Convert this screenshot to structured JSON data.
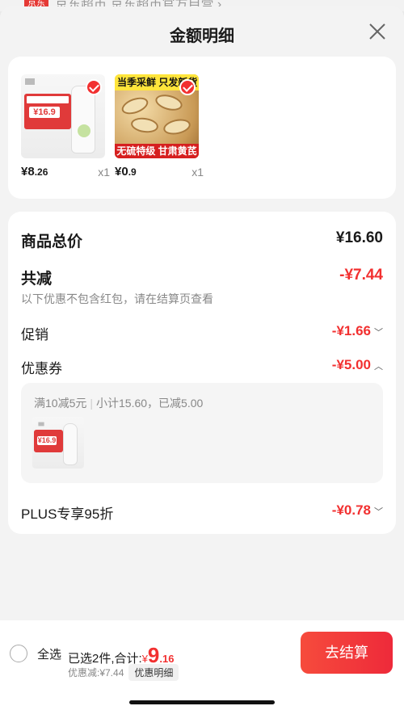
{
  "behind": {
    "tag": "京东",
    "text": "京东超市 京东超市官方自营 ›"
  },
  "sheet": {
    "title": "金额明细",
    "close_icon": "close-icon"
  },
  "products": [
    {
      "price_int": "¥8",
      "price_dec": ".26",
      "qty": "x1",
      "thumb_text": "¥16.9"
    },
    {
      "price_int": "¥0",
      "price_dec": ".9",
      "qty": "x1",
      "thumb_top": "当季采鲜 只发新货",
      "thumb_bottom": "无硫特级 甘肃黄芪"
    }
  ],
  "summary": {
    "total_label": "商品总价",
    "total_value": "¥16.60",
    "reduce_label": "共减",
    "reduce_value": "-¥7.44",
    "reduce_note": "以下优惠不包含红包，请在结算页查看",
    "promo_label": "促销",
    "promo_value": "-¥1.66",
    "coupon_label": "优惠券",
    "coupon_value": "-¥5.00",
    "coupon_rule": "满10减5元",
    "coupon_subtotal": "小计15.60，已减5.00",
    "plus_label": "PLUS专享95折",
    "plus_value": "-¥0.78"
  },
  "bottom": {
    "select_all": "全选",
    "selected_text": "已选2件,合计:",
    "currency": "¥",
    "total_int": "9",
    "total_dec": ".16",
    "discount_text": "优惠减:¥7.44",
    "detail_pill": "优惠明细",
    "checkout_label": "去结算"
  },
  "colors": {
    "accent": "#f23030",
    "button": "#f0303c"
  }
}
